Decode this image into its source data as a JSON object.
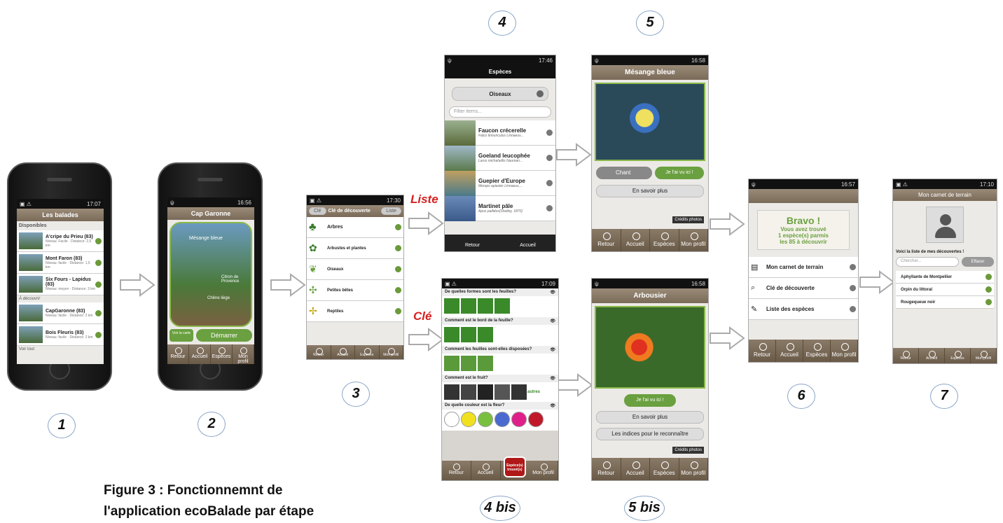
{
  "caption": {
    "line1": "Figure 3 : Fonctionnemnt de",
    "line2": "l'application ecoBalade par étape"
  },
  "steps": [
    "1",
    "2",
    "3",
    "4",
    "5",
    "6",
    "7",
    "4 bis",
    "5 bis"
  ],
  "branch_labels": {
    "liste": "Liste",
    "cle": "Clé"
  },
  "screen1": {
    "time": "17:07",
    "title": "Les balades",
    "section_available": "Disponibles",
    "items": [
      {
        "title": "A'cripe du Prieu (83)",
        "info": "Niveau: Facile · Distance: 2,5 km"
      },
      {
        "title": "Mont Faron (83)",
        "info": "Niveau: facile · Distance: 1,5 km"
      },
      {
        "title": "Six Fours - Lapidus (83)",
        "info": "Niveau: moyen · Distance: 3 km"
      }
    ],
    "section_downloaded": "À découvrir",
    "items2": [
      {
        "title": "CapGaronne (83)",
        "info": "Niveau: facile · Distance: 2 km"
      },
      {
        "title": "Bois Fleuris (83)",
        "info": "Niveau: facile · Distance: 2 km"
      }
    ],
    "more": "Voir tout"
  },
  "screen2": {
    "time": "16:56",
    "title": "Cap Garonne",
    "poi1": "Mésange bleue",
    "poi2": "Citron de Provence",
    "poi3": "Chêne liège",
    "map_btn": "Voir la carte",
    "start_btn": "Démarrer",
    "tabs": [
      "Retour",
      "Accueil",
      "Espèces",
      "Mon profil"
    ]
  },
  "screen3": {
    "time": "17:30",
    "tab_cle": "Clé",
    "title": "Clé de découverte",
    "tab_liste": "Liste",
    "items": [
      "Arbres",
      "Arbustes et plantes",
      "Oiseaux",
      "Petites bêtes",
      "Reptiles"
    ],
    "tabs": [
      "Retour",
      "Accueil",
      "Espèces",
      "Mon profil"
    ]
  },
  "screen4": {
    "time": "17:46",
    "title": "Espèces",
    "category": "Oiseaux",
    "filter_placeholder": "Filter items...",
    "items": [
      {
        "name": "Faucon crécerelle",
        "latin": "Falco tinnunculus Linnaeus..."
      },
      {
        "name": "Goeland leucophée",
        "latin": "Larus michahellis Nauman..."
      },
      {
        "name": "Guepier d'Europe",
        "latin": "Merops apiaster Linnaeus,..."
      },
      {
        "name": "Martinet pâle",
        "latin": "Apus pallidus(Shelley, 1870)"
      }
    ],
    "tabs": [
      "Retour",
      "Accueil"
    ]
  },
  "screen5": {
    "time": "16:58",
    "title": "Mésange bleue",
    "chant": "Chant",
    "seen": "Je l'ai vu ici !",
    "more": "En savoir plus",
    "credits": "Crédits photos",
    "tabs": [
      "Retour",
      "Accueil",
      "Espèces",
      "Mon profil"
    ]
  },
  "screen4bis": {
    "time": "17:09",
    "questions": [
      "De quelles formes sont les feuilles?",
      "Comment est le bord de la feuille?",
      "Comment les feuilles sont-elles disposées?",
      "Comment est le fruit?",
      "De quelle couleur est la fleur?"
    ],
    "others": "autres",
    "found_badge": "Espèce(s) trouvé(s)",
    "tabs": [
      "Retour",
      "Accueil",
      "",
      "Mon profil"
    ]
  },
  "screen5bis": {
    "time": "16:58",
    "title": "Arbousier",
    "seen": "Je l'ai vu ici !",
    "more": "En savoir plus",
    "hints": "Les indices pour le reconnaître",
    "credits": "Crédits photos",
    "tabs": [
      "Retour",
      "Accueil",
      "Espèces",
      "Mon profil"
    ]
  },
  "screen6": {
    "time": "16:57",
    "bravo": "Bravo !",
    "line1": "Vous avez trouvé",
    "line2": "1 espèce(s) parmis",
    "line3": "les 85 à découvrir",
    "menu": [
      "Mon carnet de terrain",
      "Clé de découverte",
      "Liste des espèces"
    ],
    "tabs": [
      "Retour",
      "Accueil",
      "Espèces",
      "Mon profil"
    ]
  },
  "screen7": {
    "time": "17:10",
    "title": "Mon carnet de terrain",
    "intro": "Voici la liste de mes découvertes !",
    "search_placeholder": "Chercher...",
    "clear": "Effacer",
    "items": [
      "Aphyllante de Montpellier",
      "Orpin du littoral",
      "Rougequeue noir"
    ],
    "tabs": [
      "Retour",
      "Accueil",
      "Espèces",
      "Mon profil"
    ]
  },
  "colors": {
    "brown": "#7a6a58",
    "green": "#6aa040",
    "red": "#d62020"
  }
}
